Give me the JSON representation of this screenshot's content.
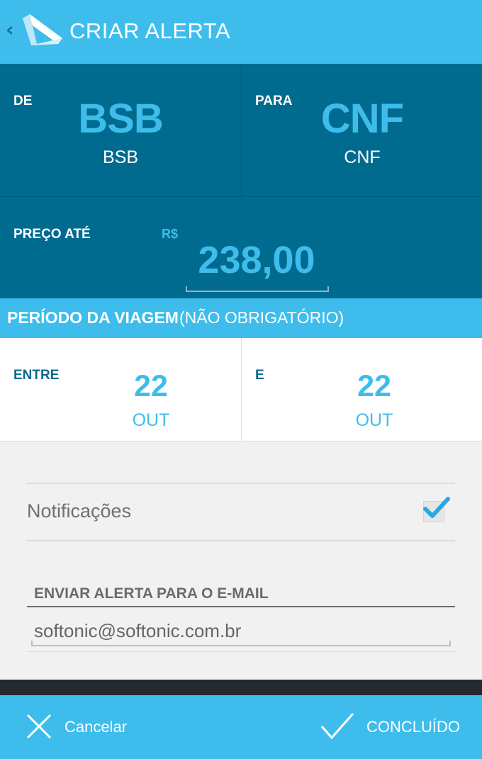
{
  "header": {
    "title": "CRIAR ALERTA",
    "back_glyph": "‹",
    "icons": [
      "chevron-left-icon",
      "app-logo-icon"
    ]
  },
  "route": {
    "from": {
      "label": "DE",
      "code": "BSB",
      "name": "BSB"
    },
    "to": {
      "label": "PARA",
      "code": "CNF",
      "name": "CNF"
    }
  },
  "price": {
    "label": "PREÇO ATÉ",
    "currency": "R$",
    "value": "238,00"
  },
  "period": {
    "title": "PERÍODO DA VIAGEM",
    "note": "(NÃO OBRIGATÓRIO)",
    "start": {
      "label": "ENTRE",
      "day": "22",
      "month": "OUT"
    },
    "end": {
      "label": "E",
      "day": "22",
      "month": "OUT"
    }
  },
  "notifications": {
    "label": "Notificações",
    "checked": true
  },
  "email": {
    "label": "ENVIAR ALERTA PARA O E-MAIL",
    "value": "softonic@softonic.com.br"
  },
  "footer": {
    "cancel_label": "Cancelar",
    "done_label": "CONCLUÍDO"
  },
  "colors": {
    "accent": "#3ebdec",
    "dark_panel": "#006b8f",
    "background": "#f1f1f1"
  }
}
